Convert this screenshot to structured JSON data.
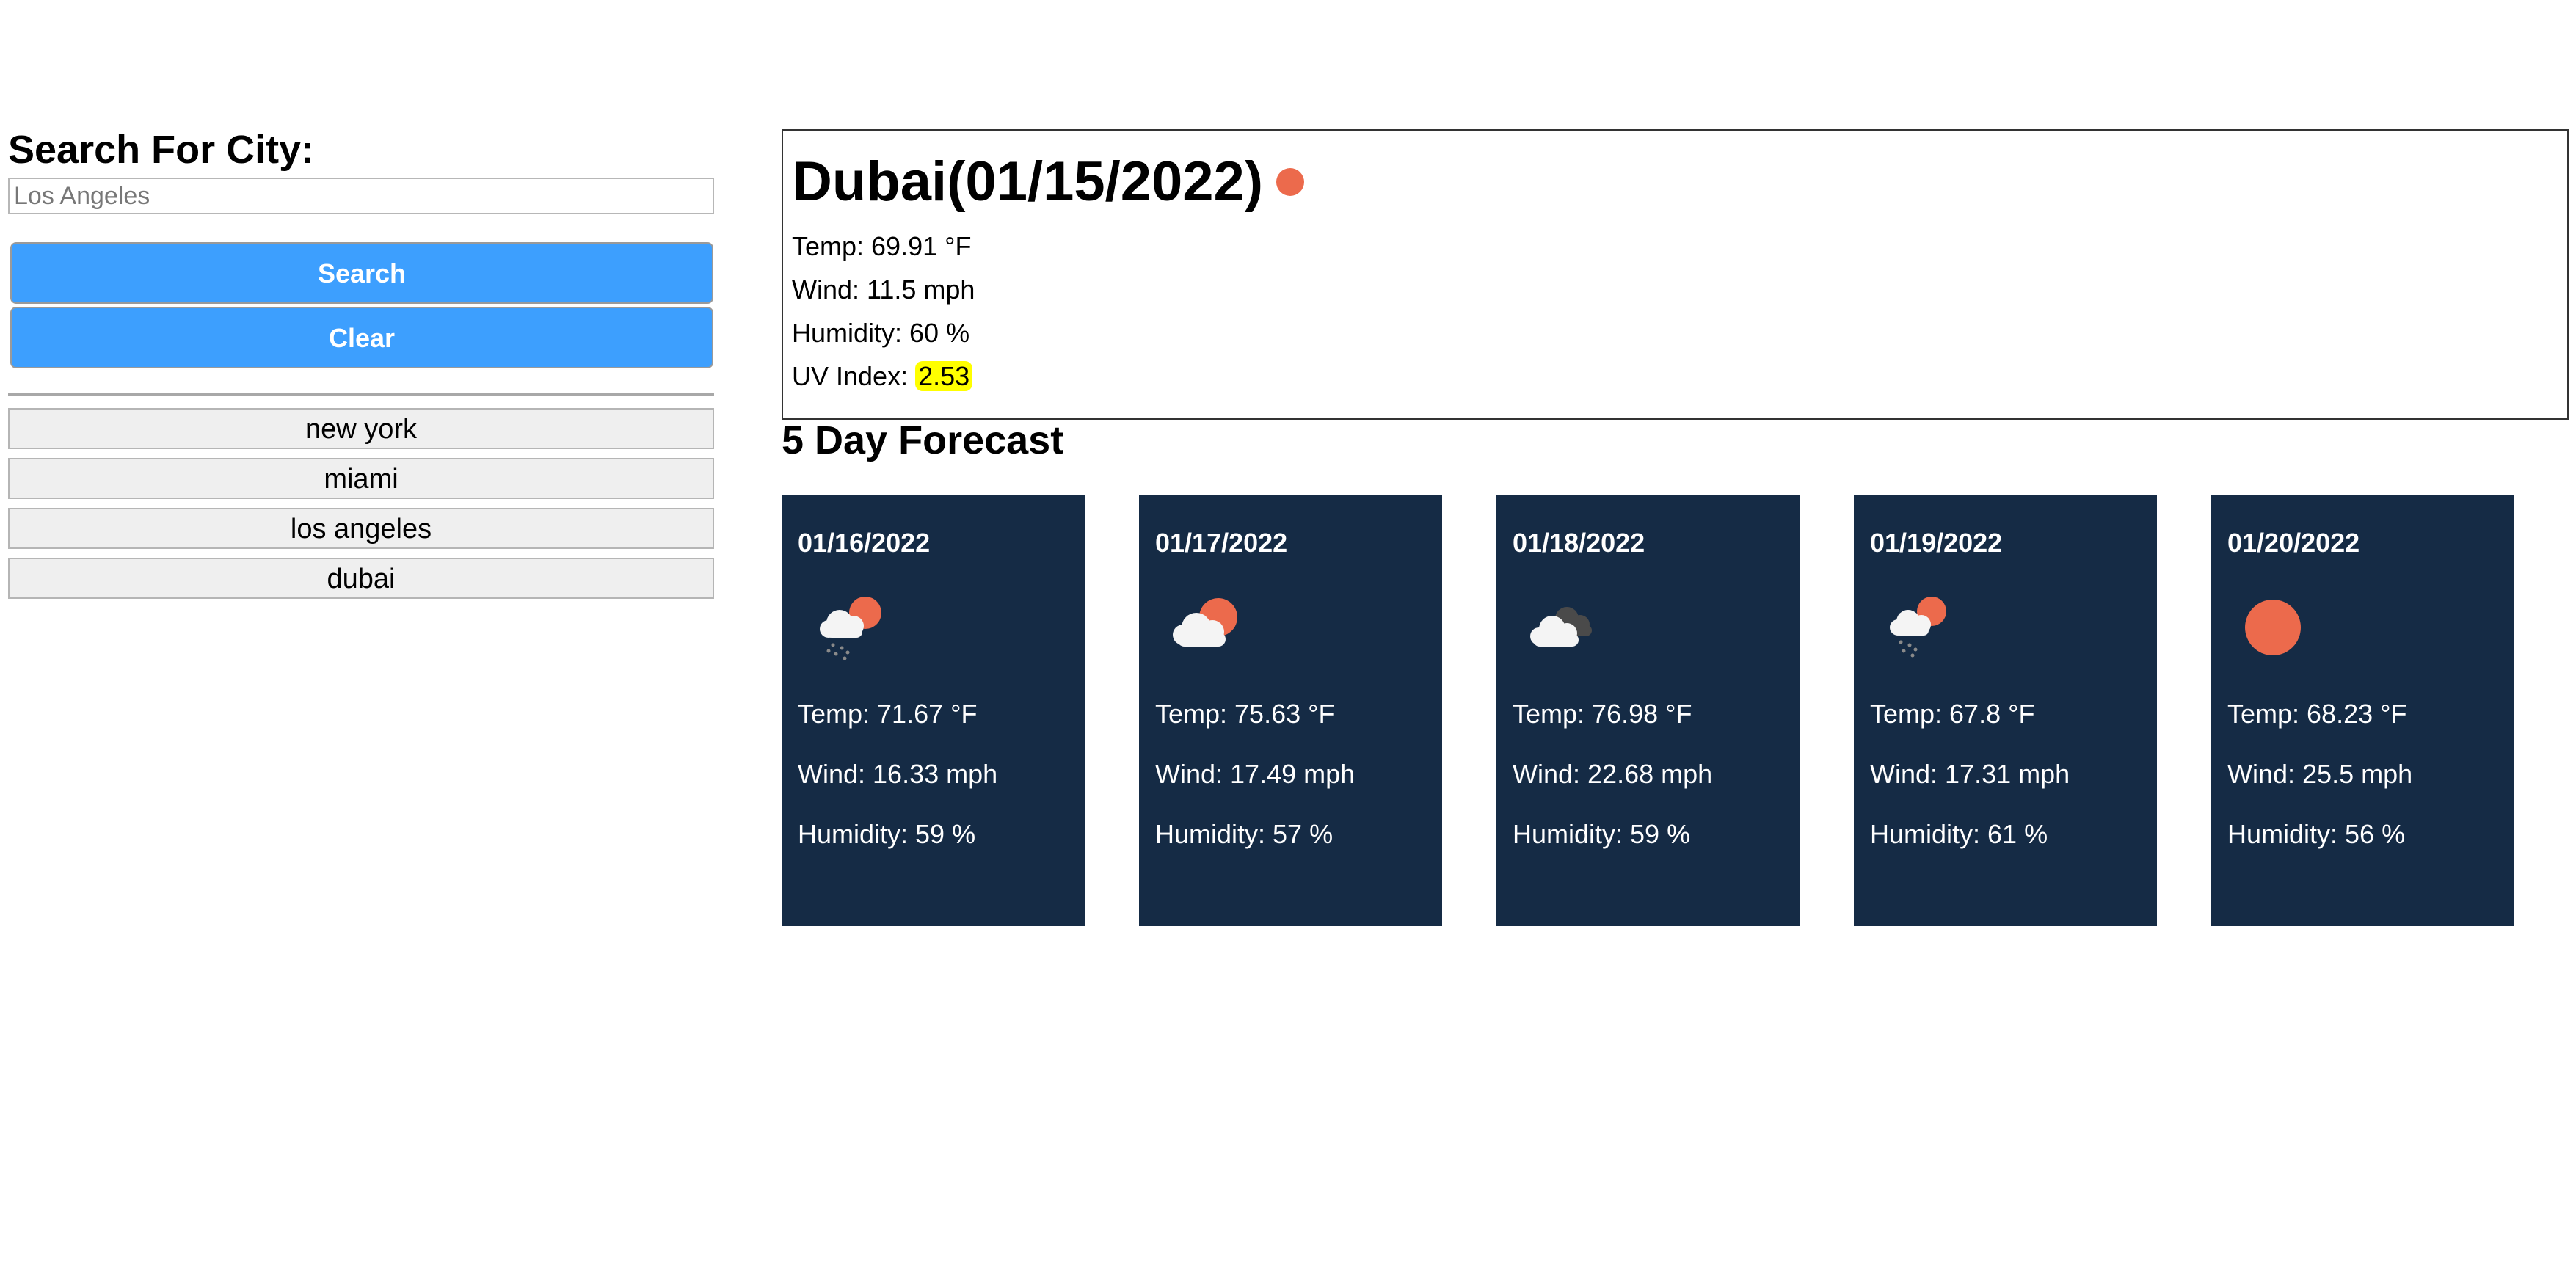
{
  "sidebar": {
    "title": "Search For City:",
    "search_placeholder": "Los Angeles",
    "search_label": "Search",
    "clear_label": "Clear",
    "history": [
      "new york",
      "miami",
      "los angeles",
      "dubai"
    ]
  },
  "current": {
    "title": "Dubai(01/15/2022)",
    "icon": "clear-sun-icon",
    "temp": "Temp: 69.91 °F",
    "wind": "Wind: 11.5 mph",
    "humidity": "Humidity: 60 %",
    "uv_label": "UV Index: ",
    "uv_value": "2.53"
  },
  "forecast": {
    "title": "5 Day Forecast",
    "days": [
      {
        "date": "01/16/2022",
        "icon": "rain-cloud-sun-icon",
        "temp": "Temp: 71.67 °F",
        "wind": "Wind: 16.33 mph",
        "humidity": "Humidity: 59 %"
      },
      {
        "date": "01/17/2022",
        "icon": "cloud-sun-icon",
        "temp": "Temp: 75.63 °F",
        "wind": "Wind: 17.49 mph",
        "humidity": "Humidity: 57 %"
      },
      {
        "date": "01/18/2022",
        "icon": "overcast-clouds-icon",
        "temp": "Temp: 76.98 °F",
        "wind": "Wind: 22.68 mph",
        "humidity": "Humidity: 59 %"
      },
      {
        "date": "01/19/2022",
        "icon": "rain-cloud-sun-icon",
        "temp": "Temp: 67.8 °F",
        "wind": "Wind: 17.31 mph",
        "humidity": "Humidity: 61 %"
      },
      {
        "date": "01/20/2022",
        "icon": "clear-sun-icon",
        "temp": "Temp: 68.23 °F",
        "wind": "Wind: 25.5 mph",
        "humidity": "Humidity: 56 %"
      }
    ]
  },
  "colors": {
    "button": "#3d9ffe",
    "card_bg": "#152b45",
    "sun": "#ec6a4c",
    "uv_highlight": "#ffff00"
  }
}
